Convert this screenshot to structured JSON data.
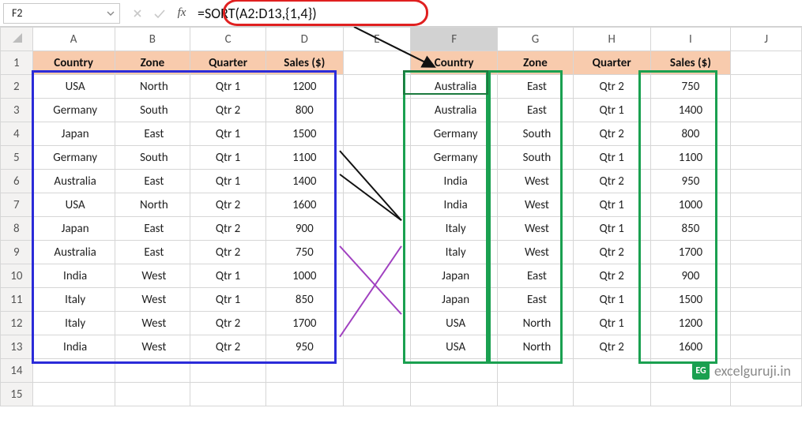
{
  "namebox": {
    "value": "F2"
  },
  "formula_bar": {
    "value": "=SORT(A2:D13,{1,4})"
  },
  "col_letters": [
    "A",
    "B",
    "C",
    "D",
    "E",
    "F",
    "G",
    "H",
    "I",
    "J"
  ],
  "headers": {
    "country": "Country",
    "zone": "Zone",
    "quarter": "Quarter",
    "sales": "Sales ($)"
  },
  "left_table": {
    "rows": [
      {
        "country": "USA",
        "zone": "North",
        "quarter": "Qtr 1",
        "sales": "1200"
      },
      {
        "country": "Germany",
        "zone": "South",
        "quarter": "Qtr 2",
        "sales": "800"
      },
      {
        "country": "Japan",
        "zone": "East",
        "quarter": "Qtr 1",
        "sales": "1500"
      },
      {
        "country": "Germany",
        "zone": "South",
        "quarter": "Qtr 1",
        "sales": "1100"
      },
      {
        "country": "Australia",
        "zone": "East",
        "quarter": "Qtr 1",
        "sales": "1400"
      },
      {
        "country": "USA",
        "zone": "North",
        "quarter": "Qtr 2",
        "sales": "1600"
      },
      {
        "country": "Japan",
        "zone": "East",
        "quarter": "Qtr 2",
        "sales": "900"
      },
      {
        "country": "Australia",
        "zone": "East",
        "quarter": "Qtr 2",
        "sales": "750"
      },
      {
        "country": "India",
        "zone": "West",
        "quarter": "Qtr 1",
        "sales": "1000"
      },
      {
        "country": "Italy",
        "zone": "West",
        "quarter": "Qtr 1",
        "sales": "850"
      },
      {
        "country": "Italy",
        "zone": "West",
        "quarter": "Qtr 2",
        "sales": "1700"
      },
      {
        "country": "India",
        "zone": "West",
        "quarter": "Qtr 2",
        "sales": "950"
      }
    ]
  },
  "right_table": {
    "rows": [
      {
        "country": "Australia",
        "zone": "East",
        "quarter": "Qtr 2",
        "sales": "750"
      },
      {
        "country": "Australia",
        "zone": "East",
        "quarter": "Qtr 1",
        "sales": "1400"
      },
      {
        "country": "Germany",
        "zone": "South",
        "quarter": "Qtr 2",
        "sales": "800"
      },
      {
        "country": "Germany",
        "zone": "South",
        "quarter": "Qtr 1",
        "sales": "1100"
      },
      {
        "country": "India",
        "zone": "West",
        "quarter": "Qtr 2",
        "sales": "950"
      },
      {
        "country": "India",
        "zone": "West",
        "quarter": "Qtr 1",
        "sales": "1000"
      },
      {
        "country": "Italy",
        "zone": "West",
        "quarter": "Qtr 1",
        "sales": "850"
      },
      {
        "country": "Italy",
        "zone": "West",
        "quarter": "Qtr 2",
        "sales": "1700"
      },
      {
        "country": "Japan",
        "zone": "East",
        "quarter": "Qtr 2",
        "sales": "900"
      },
      {
        "country": "Japan",
        "zone": "East",
        "quarter": "Qtr 1",
        "sales": "1500"
      },
      {
        "country": "USA",
        "zone": "North",
        "quarter": "Qtr 1",
        "sales": "1200"
      },
      {
        "country": "USA",
        "zone": "North",
        "quarter": "Qtr 2",
        "sales": "1600"
      }
    ]
  },
  "watermark": {
    "badge": "EG",
    "text": "excelguruji.in"
  },
  "row_numbers": [
    "1",
    "2",
    "3",
    "4",
    "5",
    "6",
    "7",
    "8",
    "9",
    "10",
    "11",
    "12",
    "13",
    "14",
    "15"
  ]
}
